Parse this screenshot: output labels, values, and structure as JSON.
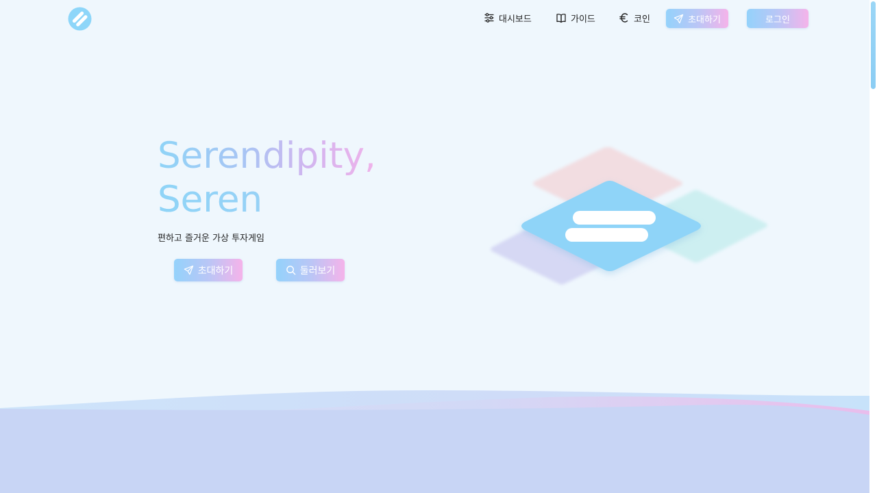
{
  "header": {
    "logo_icon": "serendipity-logo-icon",
    "nav": [
      {
        "label": "대시보드",
        "icon": "sliders-icon"
      },
      {
        "label": "가이드",
        "icon": "book-icon"
      },
      {
        "label": "코인",
        "icon": "euro-icon"
      }
    ],
    "invite_label": "초대하기",
    "login_label": "로그인"
  },
  "hero": {
    "title_line1": "Serendipity,",
    "title_line2": "Seren",
    "subtitle": "편하고 즐거운 가상 투자게임",
    "invite_label": "초대하기",
    "browse_label": "둘러보기"
  },
  "colors": {
    "background": "#eff7fd",
    "gradient_start": "#94d2fb",
    "gradient_end": "#f5b3ea",
    "brand_blue": "#8ed6f9"
  }
}
